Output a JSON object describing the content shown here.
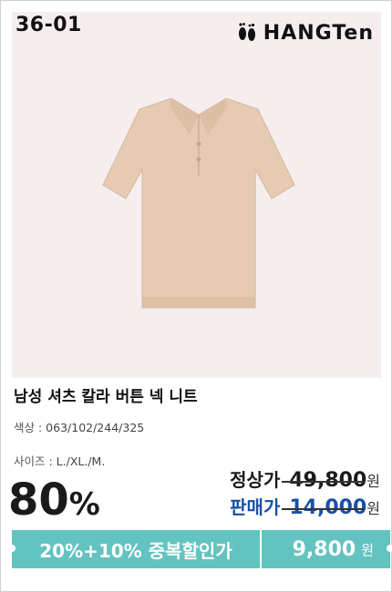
{
  "product": {
    "code": "36-01",
    "brand": "HANGTen",
    "name": "남성 셔츠 칼라 버튼 넥 니트",
    "color_label": "색상 :",
    "color_values": "063/102/244/325",
    "size_label": "사이즈 :",
    "size_values": "L./XL./M."
  },
  "pricing": {
    "discount": "80",
    "discount_unit": "%",
    "regular_label": "정상가",
    "regular_price": "49,800",
    "sale_label": "판매가",
    "sale_price": "14,000",
    "currency": "원",
    "label_color": "#1a1a1a",
    "sale_color": "#1a4fa8"
  },
  "banner": {
    "text": "20%+10% 중복할인가",
    "price": "9,800",
    "currency": "원",
    "color": "#63c3c0"
  },
  "icons": {
    "brand_logo": "footprints-icon",
    "product_image": "knit-polo-shirt"
  }
}
